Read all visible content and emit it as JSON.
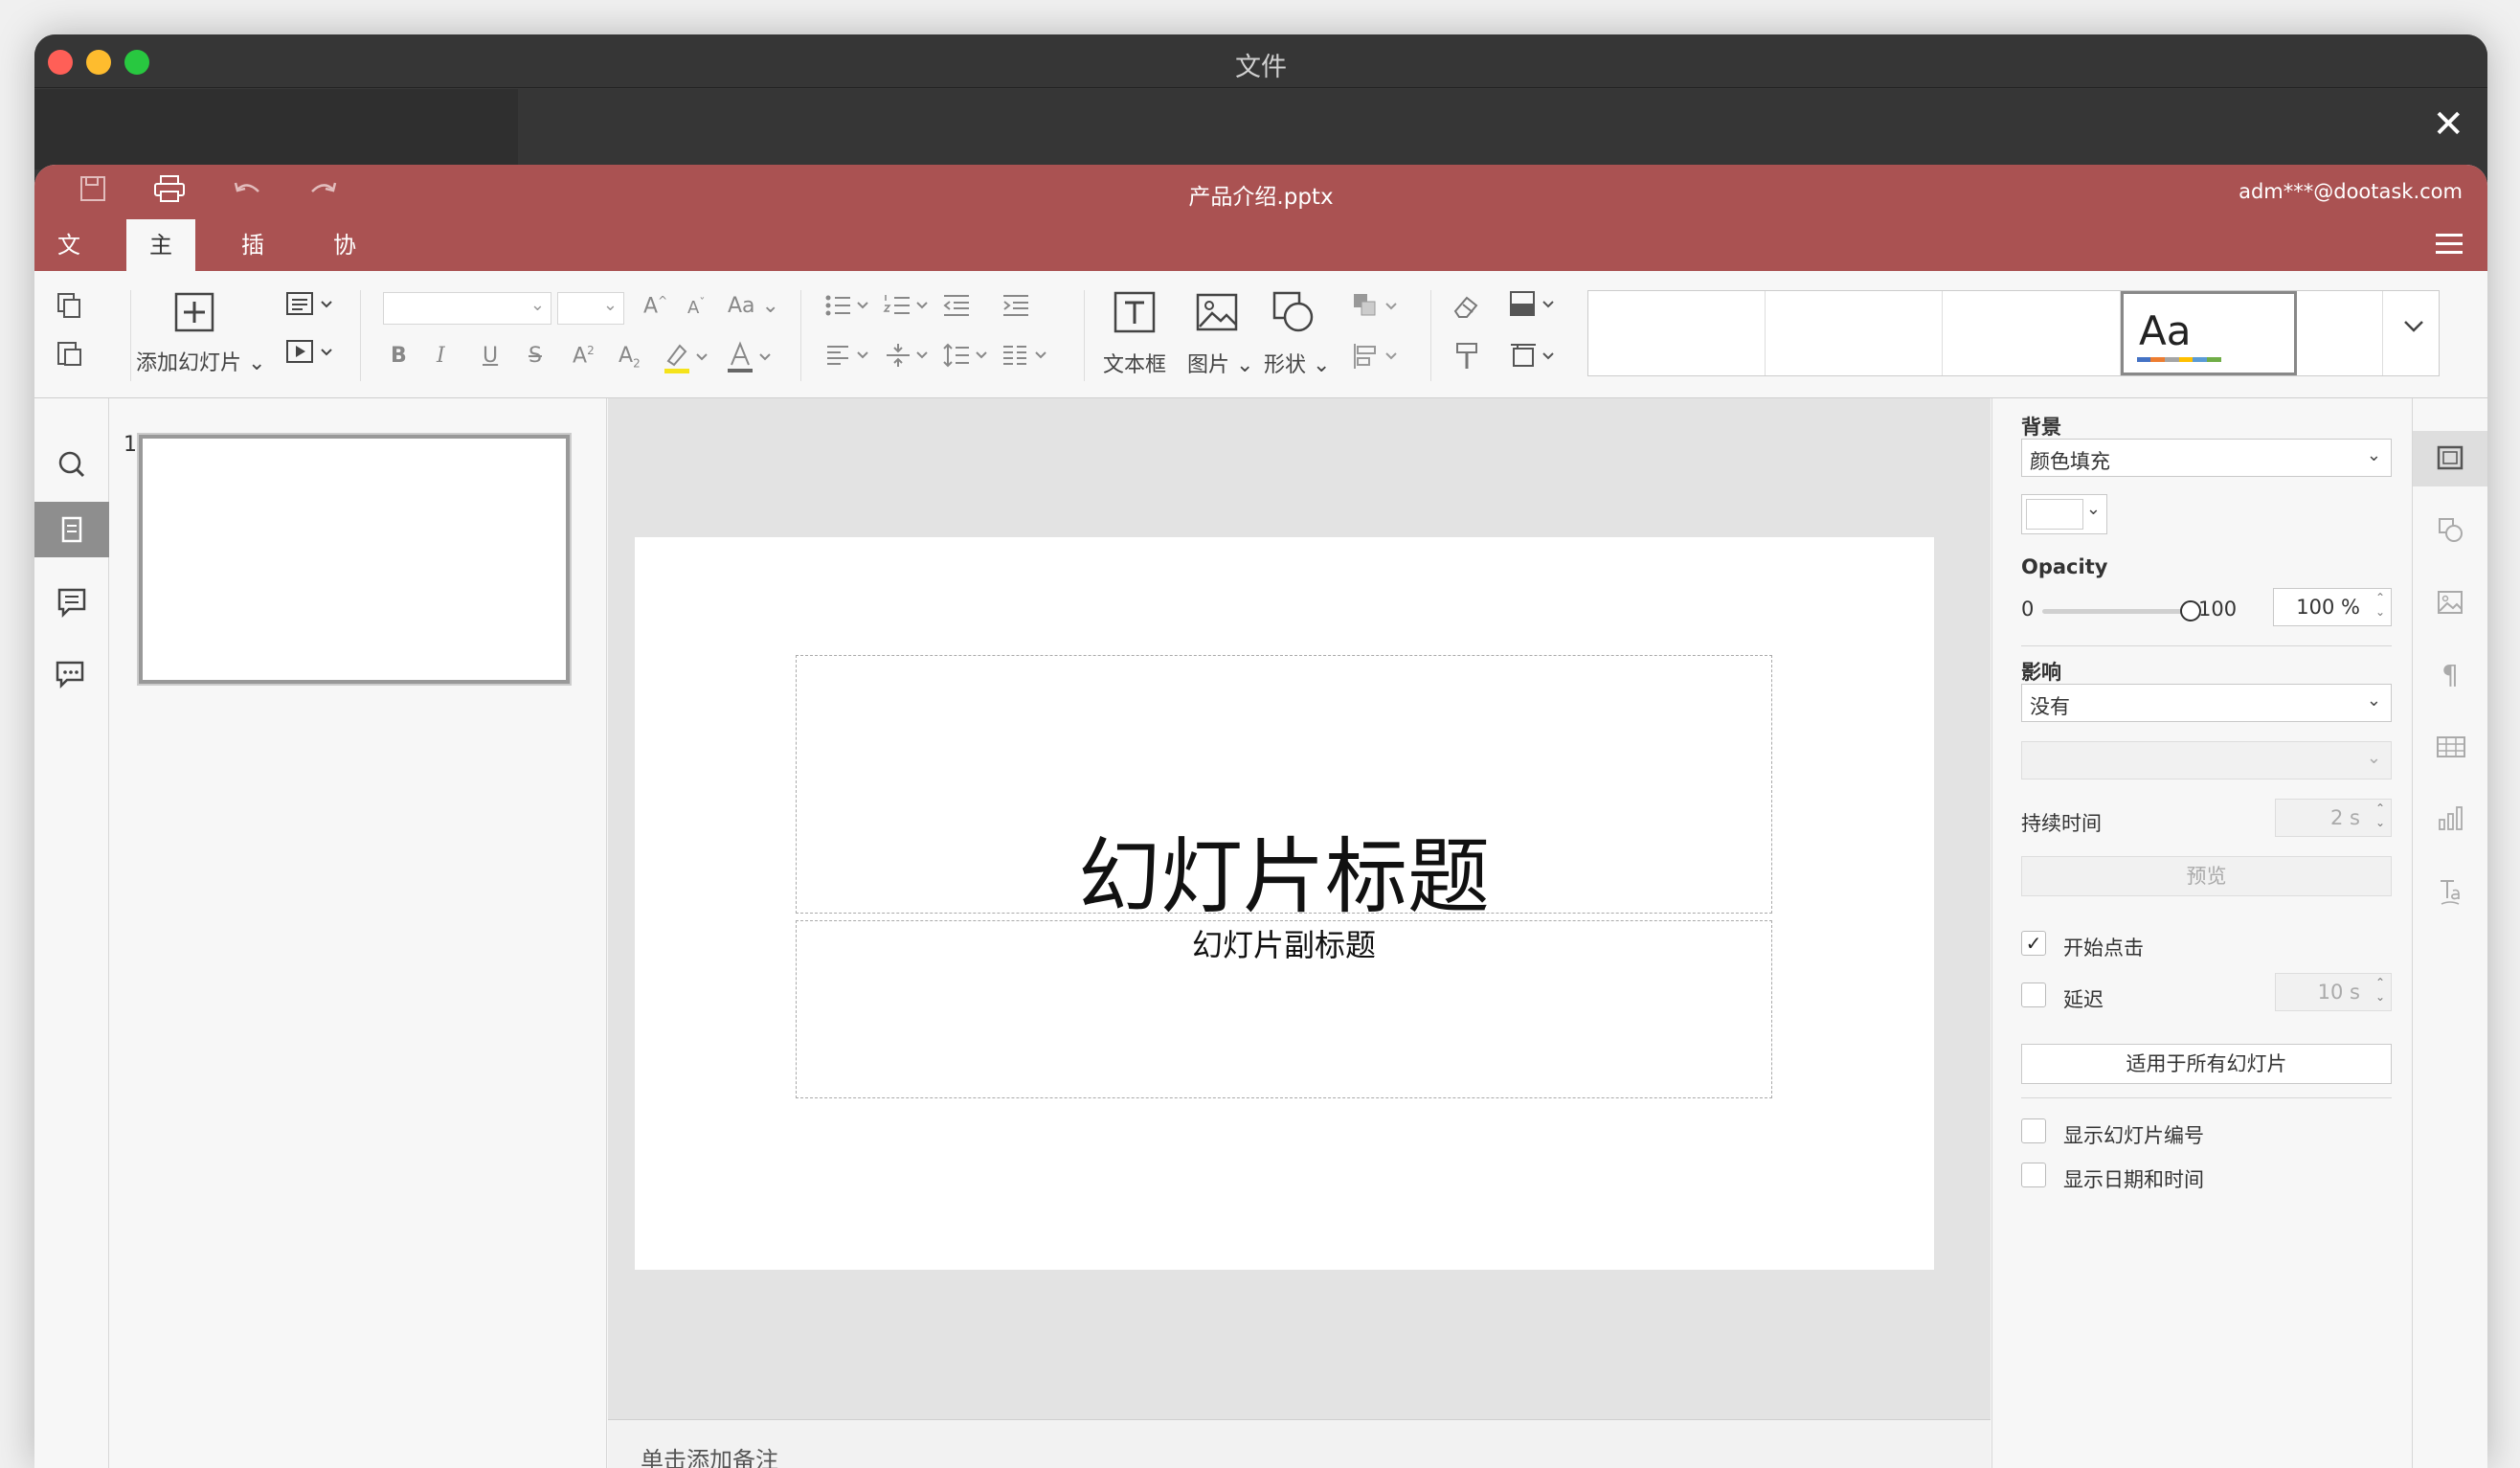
{
  "window": {
    "title": "文件",
    "close": "✕"
  },
  "header": {
    "doc_title": "产品介绍.pptx",
    "user": "adm***@dootask.com"
  },
  "tabs": [
    {
      "label": "文件"
    },
    {
      "label": "主页"
    },
    {
      "label": "插入"
    },
    {
      "label": "协作"
    }
  ],
  "toolbar": {
    "add_slide": "添加幻灯片",
    "textbox": "文本框",
    "image": "图片",
    "shape": "形状",
    "theme_sample": "Aa",
    "font_case": "Aa"
  },
  "thumbs": {
    "slide_number": "1"
  },
  "slide": {
    "title": "幻灯片标题",
    "subtitle": "幻灯片副标题"
  },
  "notes": {
    "placeholder": "单击添加备注"
  },
  "panel": {
    "background_label": "背景",
    "fill_value": "颜色填充",
    "opacity_label": "Opacity",
    "opacity_min": "0",
    "opacity_max": "100",
    "opacity_value": "100 %",
    "opacity_level": 1.0,
    "effect_label": "影响",
    "effect_value": "没有",
    "duration_label": "持续时间",
    "duration_value": "2 s",
    "preview_button": "预览",
    "start_on_click": "开始点击",
    "delay_label": "延迟",
    "delay_value": "10 s",
    "apply_all_button": "适用于所有幻灯片",
    "show_slide_number": "显示幻灯片编号",
    "show_datetime": "显示日期和时间"
  },
  "colors": {
    "header": "#aa5252",
    "titlebar": "#363636",
    "accent_active": "#8e8e8e"
  }
}
